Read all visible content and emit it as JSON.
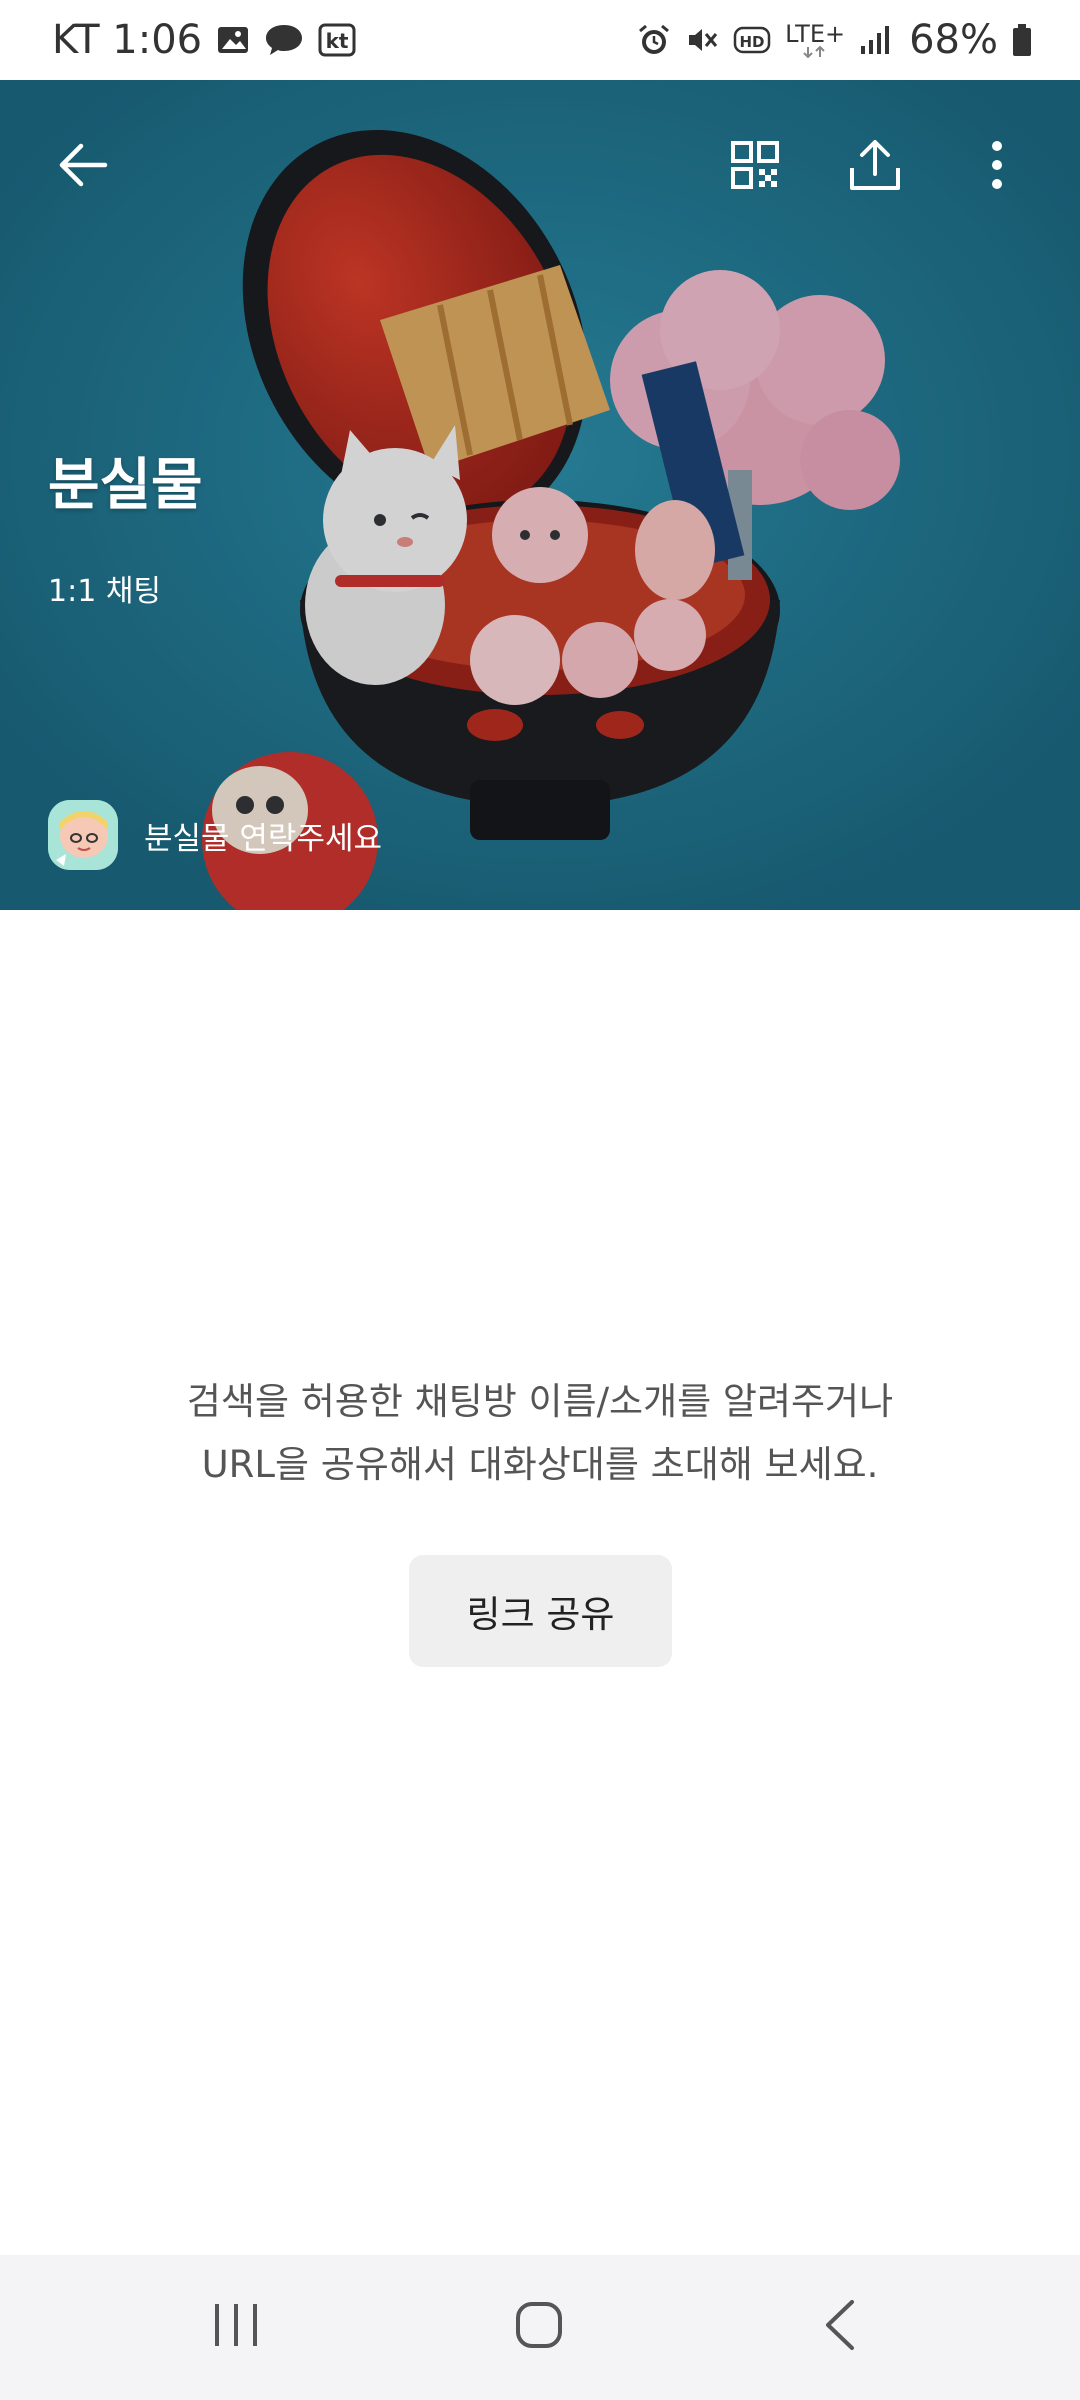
{
  "status_bar": {
    "carrier_time": "KT 1:06",
    "network": "LTE+",
    "battery": "68%"
  },
  "header": {
    "title": "분실물",
    "subtitle": "1:1 채팅",
    "owner_name": "분실물 연락주세요"
  },
  "main": {
    "invite_line1": "검색을 허용한 채팅방 이름/소개를 알려주거나",
    "invite_line2": "URL을 공유해서 대화상대를 초대해 보세요.",
    "share_link_label": "링크 공유"
  },
  "colors": {
    "hero_bg": "#1f6f86",
    "button_bg": "#efefef",
    "nav_bg": "#f4f4f6"
  },
  "icons": {
    "back": "arrow-left-icon",
    "qr": "qr-code-icon",
    "share": "share-upload-icon",
    "more": "more-vertical-icon"
  }
}
